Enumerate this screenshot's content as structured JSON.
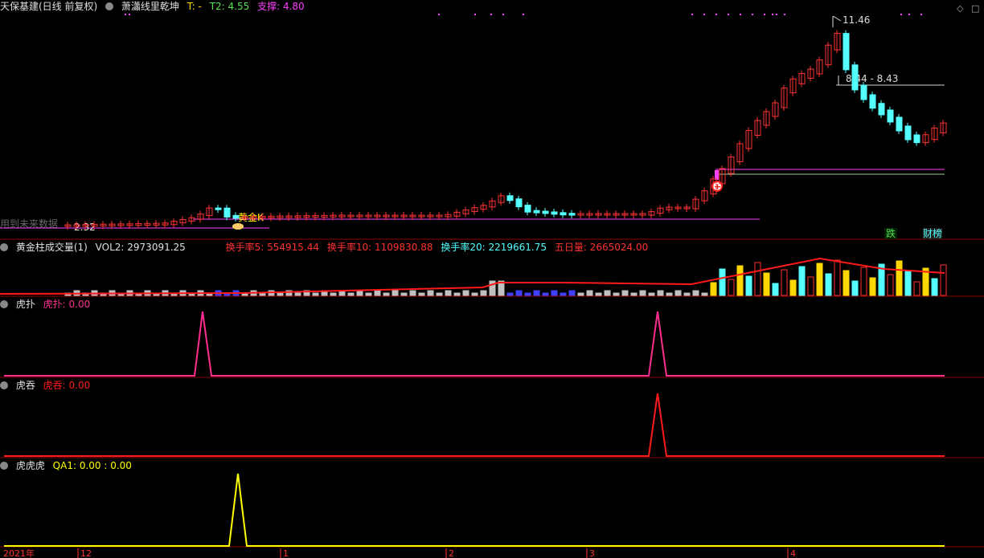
{
  "colors": {
    "up": "#ff3232",
    "down": "#54ffff",
    "pink": "#ff2f8f",
    "red": "#ff1a1a",
    "yellow": "#ffff00",
    "magenta": "#ff40ff",
    "green": "#50e050",
    "grid": "#8b0000"
  },
  "main": {
    "stock": "天保基建(日线 前复权)",
    "indicator": "萧瀟线里乾坤",
    "t_label": "T: -",
    "t2_label": "T2: 4.55",
    "support_label": "支撑: 4.80",
    "high_label": "11.46",
    "mid_label": "8.44 - 8.43",
    "low_label": "2.32",
    "golden_label": "黄金K",
    "nodata_label": "用到未来数据",
    "tag_die": "跌",
    "tag_cai": "财榜"
  },
  "vol": {
    "name": "黄金柱成交量(1)",
    "vol2": "VOL2: 2973091.25",
    "h5": "换手率5: 554915.44",
    "h10": "换手率10: 1109830.88",
    "h20": "换手率20: 2219661.75",
    "w5": "五日量: 2665024.00"
  },
  "p1": {
    "name": "虎扑",
    "label": "虎扑: 0.00"
  },
  "p2": {
    "name": "虎吞",
    "label": "虎吞: 0.00"
  },
  "p3": {
    "name": "虎虎虎",
    "label": "QA1: 0.00 : 0.00"
  },
  "x_axis": [
    "2021年",
    "12",
    "1",
    "2",
    "3",
    "4"
  ],
  "chart_data": [
    {
      "type": "line",
      "name": "虎扑",
      "x": [
        "2021年",
        "12",
        "1",
        "2",
        "3",
        "4"
      ],
      "spikes": [
        {
          "value": 1,
          "category": "12"
        },
        {
          "value": 1,
          "category": "3"
        }
      ]
    },
    {
      "type": "line",
      "name": "虎吞",
      "spikes": [
        {
          "value": 1,
          "category": "3"
        }
      ]
    },
    {
      "type": "line",
      "name": "虎虎虎",
      "spikes": [
        {
          "value": 1,
          "category": "12"
        }
      ]
    }
  ]
}
